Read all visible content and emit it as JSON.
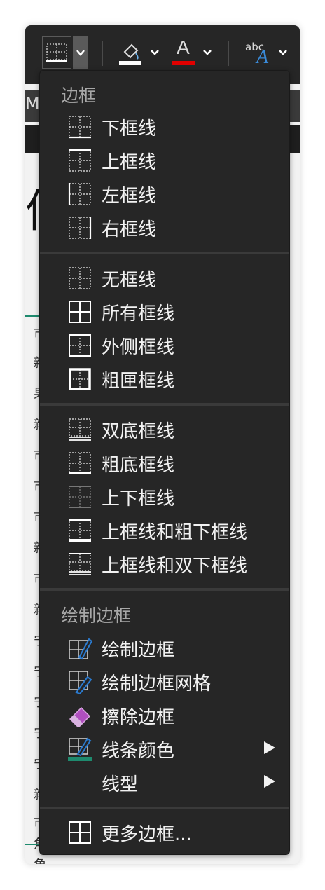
{
  "toolbar": {
    "text_color_letter": "A",
    "text_effects_small": "abc",
    "text_effects_letter": "A",
    "fill_color": "#ffffff",
    "font_color": "#e00000"
  },
  "sheet": {
    "header_letter": "M",
    "big_char": "信",
    "column_chars": [
      "市",
      "新",
      "果",
      "新",
      "市",
      "市",
      "市",
      "新",
      "市",
      "新",
      "宁",
      "宁",
      "宁",
      "宁",
      "宁",
      "新",
      "市",
      "角",
      "角"
    ]
  },
  "menu": {
    "borders_title": "边框",
    "group1": [
      {
        "label": "下框线",
        "icon": "border-bottom-icon"
      },
      {
        "label": "上框线",
        "icon": "border-top-icon"
      },
      {
        "label": "左框线",
        "icon": "border-left-icon"
      },
      {
        "label": "右框线",
        "icon": "border-right-icon"
      }
    ],
    "group2": [
      {
        "label": "无框线",
        "icon": "border-none-icon"
      },
      {
        "label": "所有框线",
        "icon": "border-all-icon"
      },
      {
        "label": "外侧框线",
        "icon": "border-outside-icon"
      },
      {
        "label": "粗匣框线",
        "icon": "border-thick-box-icon"
      }
    ],
    "group3": [
      {
        "label": "双底框线",
        "icon": "border-double-bottom-icon"
      },
      {
        "label": "粗底框线",
        "icon": "border-thick-bottom-icon"
      },
      {
        "label": "上下框线",
        "icon": "border-top-bottom-icon"
      },
      {
        "label": "上框线和粗下框线",
        "icon": "border-top-thick-bottom-icon"
      },
      {
        "label": "上框线和双下框线",
        "icon": "border-top-double-bottom-icon"
      }
    ],
    "draw_title": "绘制边框",
    "group4": [
      {
        "label": "绘制边框",
        "icon": "draw-border-icon"
      },
      {
        "label": "绘制边框网格",
        "icon": "draw-border-grid-icon"
      },
      {
        "label": "擦除边框",
        "icon": "eraser-icon"
      },
      {
        "label": "线条颜色",
        "icon": "line-color-icon"
      },
      {
        "label": "线型",
        "icon": ""
      }
    ],
    "more_borders": "更多边框..."
  },
  "colors": {
    "line_color_swatch": "#1e8a6e",
    "pencil_blue": "#2b7bd0",
    "eraser_purple": "#b04fbf"
  }
}
